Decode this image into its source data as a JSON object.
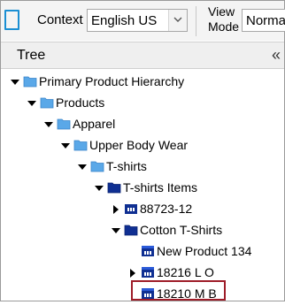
{
  "toolbar": {
    "context_label": "Context",
    "context_value": "English US",
    "viewmode_label": "View Mode",
    "viewmode_value": "Normal"
  },
  "tree": {
    "title": "Tree",
    "collapse_symbol": "«",
    "nodes": [
      {
        "label": "Primary Product Hierarchy",
        "expanded": true,
        "icon": "folder-light-icon"
      },
      {
        "label": "Products",
        "expanded": true,
        "icon": "folder-light-icon"
      },
      {
        "label": "Apparel",
        "expanded": true,
        "icon": "folder-light-icon"
      },
      {
        "label": "Upper Body Wear",
        "expanded": true,
        "icon": "folder-light-icon"
      },
      {
        "label": "T-shirts",
        "expanded": true,
        "icon": "folder-light-icon"
      },
      {
        "label": "T-shirts Items",
        "expanded": true,
        "icon": "folder-dark-icon"
      },
      {
        "label": "88723-12",
        "expanded": false,
        "icon": "product-family-icon"
      },
      {
        "label": "Cotton T-Shirts",
        "expanded": true,
        "icon": "folder-dark-icon"
      },
      {
        "label": "New Product 134",
        "expanded": null,
        "icon": "product-icon"
      },
      {
        "label": "18216 L O",
        "expanded": false,
        "icon": "product-icon"
      },
      {
        "label": "18210 M B",
        "expanded": null,
        "icon": "product-icon",
        "selected": true
      }
    ]
  },
  "colors": {
    "accent": "#1b8fd3",
    "folder_light": "#5aa8e8",
    "folder_dark": "#0f2f92",
    "highlight_border": "#9e1c28"
  }
}
